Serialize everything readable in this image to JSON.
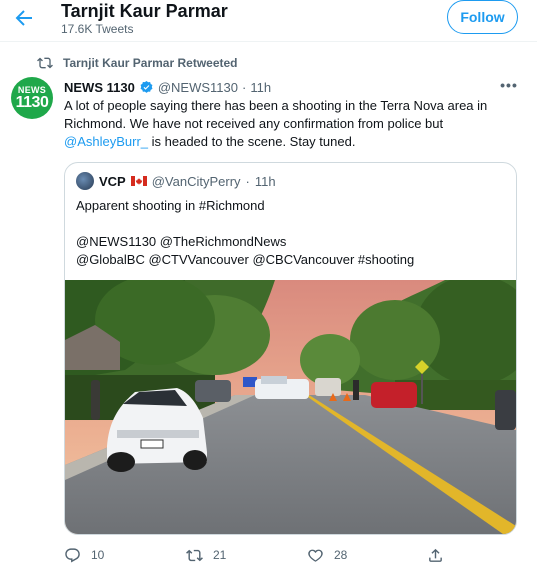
{
  "header": {
    "back_icon": "arrow-left-icon",
    "name": "Tarnjit Kaur Parmar",
    "tweet_count": "17.6K Tweets",
    "follow_label": "Follow"
  },
  "retweet_context": {
    "icon": "retweet-icon",
    "label": "Tarnjit Kaur Parmar Retweeted"
  },
  "tweet": {
    "avatar_top": "NEWS",
    "avatar_bottom": "1130",
    "name": "NEWS 1130",
    "verified_icon": "verified-badge-icon",
    "handle": "@NEWS1130",
    "dot": "·",
    "time": "11h",
    "more_icon": "more-icon",
    "more_glyph": "•••",
    "text_before": "A lot of people saying there has been a shooting in the Terra Nova area in Richmond. We have not received any confirmation from police but ",
    "mention": "@AshleyBurr_",
    "text_after": " is headed to the scene. Stay tuned."
  },
  "quoted": {
    "name": "VCP",
    "flag_icon": "canada-flag-icon",
    "handle": "@VanCityPerry",
    "dot": "·",
    "time": "11h",
    "lines": [
      "Apparent shooting in #Richmond",
      "",
      "@NEWS1130 @TheRichmondNews",
      "@GlobalBC @CTVVancouver @CBCVancouver #shooting"
    ],
    "media_icon": "street-photo"
  },
  "actions": {
    "reply_icon": "reply-icon",
    "reply_count": "10",
    "retweet_icon": "retweet-icon",
    "retweet_count": "21",
    "like_icon": "heart-icon",
    "like_count": "28",
    "share_icon": "share-icon"
  },
  "colors": {
    "accent": "#1d9bf0",
    "muted": "#536471",
    "border": "#cfd9de",
    "news_green": "#1fa84a"
  }
}
